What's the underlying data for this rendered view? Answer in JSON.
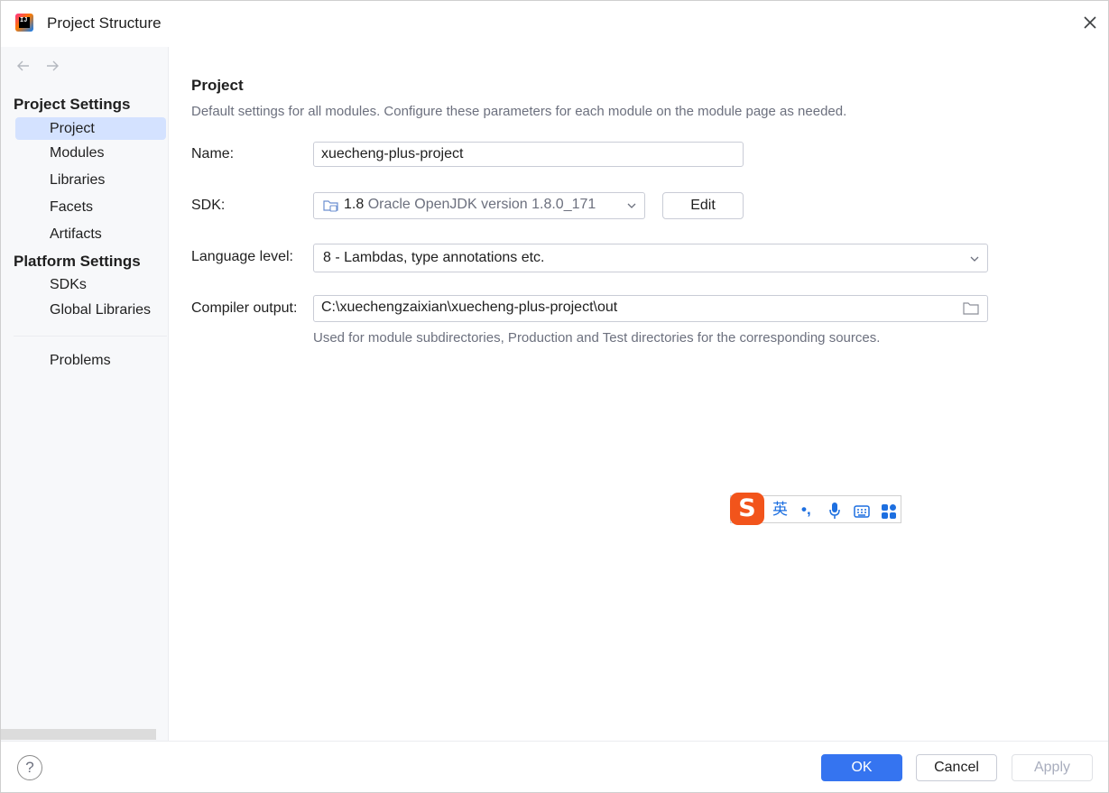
{
  "window": {
    "title": "Project Structure"
  },
  "sidebar": {
    "section_project_settings": "Project Settings",
    "project_settings_items": [
      {
        "label": "Project",
        "selected": true
      },
      {
        "label": "Modules"
      },
      {
        "label": "Libraries"
      },
      {
        "label": "Facets"
      },
      {
        "label": "Artifacts"
      }
    ],
    "section_platform_settings": "Platform Settings",
    "platform_settings_items": [
      {
        "label": "SDKs"
      },
      {
        "label": "Global Libraries"
      }
    ],
    "problems_label": "Problems"
  },
  "main": {
    "title": "Project",
    "description": "Default settings for all modules. Configure these parameters for each module on the module page as needed.",
    "name": {
      "label": "Name:",
      "value": "xuecheng-plus-project"
    },
    "sdk": {
      "label": "SDK:",
      "version": "1.8",
      "description": "Oracle OpenJDK version 1.8.0_171",
      "edit_label": "Edit"
    },
    "language_level": {
      "label": "Language level:",
      "value": "8 - Lambdas, type annotations etc."
    },
    "compiler_output": {
      "label": "Compiler output:",
      "value": "C:\\xuechengzaixian\\xuecheng-plus-project\\out",
      "hint": "Used for module subdirectories, Production and Test directories for the corresponding sources."
    }
  },
  "ime_toolbar": {
    "logo": "S",
    "mode": "英",
    "punct": "•,"
  },
  "footer": {
    "help": "?",
    "ok_label": "OK",
    "cancel_label": "Cancel",
    "apply_label": "Apply"
  },
  "colors": {
    "primary_button": "#3574f0",
    "selection": "#d4e2ff",
    "ime_logo": "#f2541b"
  }
}
